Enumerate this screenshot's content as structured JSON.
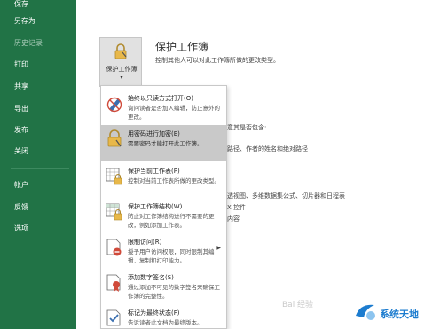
{
  "nav": {
    "items": [
      {
        "label": "保存"
      },
      {
        "label": "另存为"
      },
      {
        "label": "历史记录"
      },
      {
        "label": "打印"
      },
      {
        "label": "共享"
      },
      {
        "label": "导出"
      },
      {
        "label": "发布"
      },
      {
        "label": "关闭"
      },
      {
        "label": "帐户"
      },
      {
        "label": "反馈"
      },
      {
        "label": "选项"
      }
    ]
  },
  "protect": {
    "tile_label": "保护工作簿",
    "title": "保护工作簿",
    "description": "控制其他人可以对此工作簿所做的更改类型。"
  },
  "background_text": {
    "line1": "意其是否包含:",
    "line2": "路径、作者的姓名和绝对路径",
    "line3": "透视图、多维数据集公式、切片器和日程表",
    "line4": "X 控件",
    "line5": "内容"
  },
  "menu": {
    "items": [
      {
        "title": "始终以只读方式打开(O)",
        "desc": "询问读者是否加入编辑，防止意外的更改。",
        "icon": "pencil-no-icon"
      },
      {
        "title": "用密码进行加密(E)",
        "desc": "需要密码才能打开此工作簿。",
        "icon": "lock-key-icon"
      },
      {
        "title": "保护当前工作表(P)",
        "desc": "控制对当前工作表所做的更改类型。",
        "icon": "sheet-lock-icon"
      },
      {
        "title": "保护工作簿结构(W)",
        "desc": "防止对工作簿结构进行不需要的更改，例如添加工作表。",
        "icon": "workbook-lock-icon"
      },
      {
        "title": "限制访问(R)",
        "desc": "授予用户访问权限，同时限制其编辑、复制和打印能力。",
        "icon": "restrict-access-icon"
      },
      {
        "title": "添加数字签名(S)",
        "desc": "通过添加不可见的数字签名来确保工作簿的完整性。",
        "icon": "digital-signature-icon"
      },
      {
        "title": "标记为最终状态(F)",
        "desc": "告诉读者此文档为最终版本。",
        "icon": "mark-final-icon"
      }
    ]
  },
  "watermark": {
    "site": "系统天地",
    "baidu": "Bai 经验"
  },
  "colors": {
    "nav_bg": "#217346",
    "selected_item": "#c9c9c9",
    "watermark_blue": "#1c7ccf"
  }
}
